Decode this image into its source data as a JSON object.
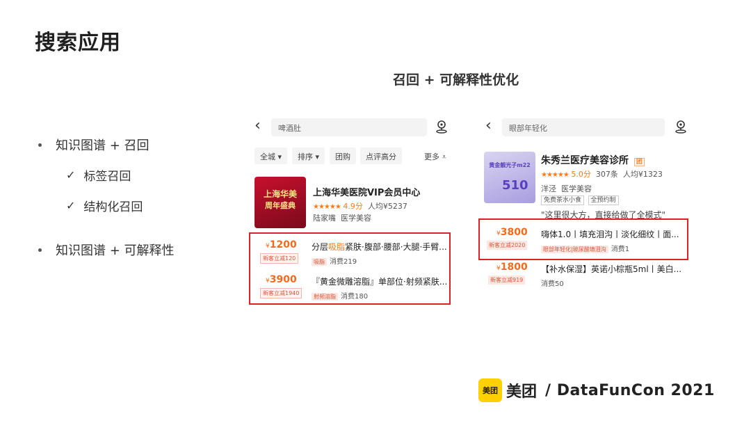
{
  "slide": {
    "title": "搜索应用",
    "subtitle": "召回 + 可解释性优化"
  },
  "bullets": [
    {
      "text": "知识图谱 + 召回",
      "subs": [
        "标签召回",
        "结构化召回"
      ]
    },
    {
      "text": "知识图谱 + 可解释性"
    }
  ],
  "left_phone": {
    "back_icon": "chevron-left-icon",
    "search_text": "啤酒肚",
    "filters": [
      "全城 ▾",
      "排序 ▾",
      "团购",
      "点评高分"
    ],
    "more_label": "更多",
    "store": {
      "image_text_1": "上海华美",
      "image_text_2": "周年盛典",
      "name": "上海华美医院VIP会员中心",
      "stars": "★★★★★",
      "rating": "4.9分",
      "avg_price": "人均¥5237",
      "location": "陆家嘴",
      "category": "医学美容"
    },
    "deals": [
      {
        "price": "1200",
        "reduce": "新客立减120",
        "title_pre": "分层",
        "title_hl": "吸脂",
        "title_post": "紧肤·腹部·腰部·大腿·手臂...",
        "tag": "吸脂",
        "consume": "消费219"
      },
      {
        "price": "3900",
        "reduce": "新客立减1940",
        "title": "『黄金微雕溶脂』单部位·射频紧肤...",
        "tag": "射频溶脂",
        "consume": "消费180"
      }
    ]
  },
  "right_phone": {
    "back_icon": "chevron-left-icon",
    "search_text": "眼部年轻化",
    "store": {
      "image_text_1": "黄金靓光子m22",
      "image_text_2": "510",
      "name": "朱秀兰医疗美容诊所",
      "badge": "团",
      "stars": "★★★★★",
      "rating": "5.0分",
      "reviews": "307条",
      "avg_price": "人均¥1323",
      "location": "洋泾",
      "category": "医学美容",
      "tags": [
        "免费茶水小食",
        "全预约制"
      ],
      "review": "\"这里很大方，直接给做了全模式\""
    },
    "deals": [
      {
        "price": "3800",
        "reduce": "新客立减2020",
        "title": "嗨体1.0丨填充泪沟丨淡化细纹丨面...",
        "tag": "眼部年轻化|玻尿酸填泪沟",
        "consume": "消费1"
      },
      {
        "price": "1800",
        "reduce": "新客立减919",
        "title": "【补水保湿】英诺小棕瓶5ml丨美白...",
        "consume": "消费50"
      }
    ]
  },
  "footer": {
    "logo_box": "美团",
    "brand": "美团",
    "event": "/ DataFunCon 2021"
  },
  "colors": {
    "accent": "#ff7a1a",
    "highlight": "#e02020",
    "meituan_yellow": "#ffd100"
  }
}
